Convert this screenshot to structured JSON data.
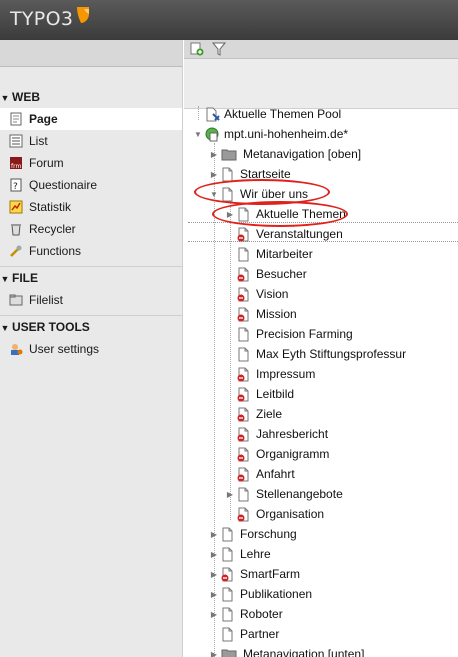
{
  "app": {
    "logo_text": "TYPO3"
  },
  "left_menu": {
    "sections": [
      {
        "title": "WEB",
        "items": [
          {
            "label": "Page",
            "icon": "page-icon",
            "active": true
          },
          {
            "label": "List",
            "icon": "list-icon"
          },
          {
            "label": "Forum",
            "icon": "forum-icon"
          },
          {
            "label": "Questionaire",
            "icon": "questionaire-icon"
          },
          {
            "label": "Statistik",
            "icon": "statistik-icon"
          },
          {
            "label": "Recycler",
            "icon": "recycler-icon"
          },
          {
            "label": "Functions",
            "icon": "functions-icon"
          }
        ]
      },
      {
        "title": "FILE",
        "items": [
          {
            "label": "Filelist",
            "icon": "filelist-icon"
          }
        ]
      },
      {
        "title": "USER TOOLS",
        "items": [
          {
            "label": "User settings",
            "icon": "user-settings-icon"
          }
        ]
      }
    ]
  },
  "tree": {
    "pool_label": "Aktuelle Themen Pool",
    "root_label": "mpt.uni-hohenheim.de*",
    "level1_top": [
      {
        "label": "Metanavigation [oben]",
        "type": "folder",
        "expander": "collapsed"
      },
      {
        "label": "Startseite",
        "type": "page",
        "expander": "collapsed"
      },
      {
        "label": "Wir über uns",
        "type": "page",
        "expander": "expanded"
      }
    ],
    "level2": [
      {
        "label": "Aktuelle Themen",
        "type": "page",
        "expander": "collapsed"
      },
      {
        "label": "Veranstaltungen",
        "type": "hidden"
      },
      {
        "label": "Mitarbeiter",
        "type": "page"
      },
      {
        "label": "Besucher",
        "type": "hidden"
      },
      {
        "label": "Vision",
        "type": "hidden"
      },
      {
        "label": "Mission",
        "type": "hidden"
      },
      {
        "label": "Precision Farming",
        "type": "page"
      },
      {
        "label": "Max Eyth Stiftungsprofessur",
        "type": "page"
      },
      {
        "label": "Impressum",
        "type": "hidden"
      },
      {
        "label": "Leitbild",
        "type": "hidden"
      },
      {
        "label": "Ziele",
        "type": "hidden"
      },
      {
        "label": "Jahresbericht",
        "type": "hidden"
      },
      {
        "label": "Organigramm",
        "type": "hidden"
      },
      {
        "label": "Anfahrt",
        "type": "hidden"
      },
      {
        "label": "Stellenangebote",
        "type": "page",
        "expander": "collapsed"
      },
      {
        "label": "Organisation",
        "type": "hidden"
      }
    ],
    "level1_bottom": [
      {
        "label": "Forschung",
        "type": "page",
        "expander": "collapsed"
      },
      {
        "label": "Lehre",
        "type": "page",
        "expander": "collapsed"
      },
      {
        "label": "SmartFarm",
        "type": "hidden",
        "expander": "collapsed"
      },
      {
        "label": "Publikationen",
        "type": "page",
        "expander": "collapsed"
      },
      {
        "label": "Roboter",
        "type": "page",
        "expander": "collapsed"
      },
      {
        "label": "Partner",
        "type": "page"
      },
      {
        "label": "Metanavigation [unten]",
        "type": "folder",
        "expander": "collapsed"
      }
    ]
  },
  "colors": {
    "annotation_red": "#e0201a",
    "logo_orange": "#f49700"
  }
}
